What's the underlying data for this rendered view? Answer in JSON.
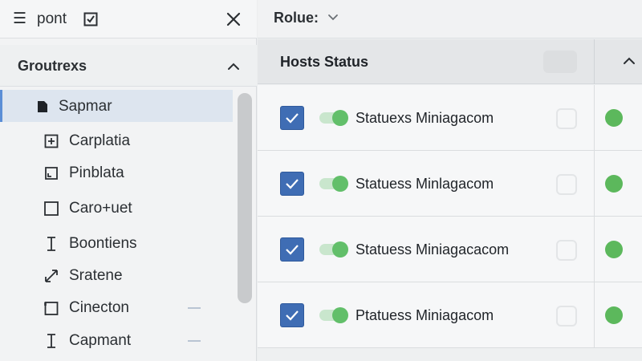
{
  "colors": {
    "accent": "#3f6db4",
    "selected_bg": "#dde5ef",
    "status_ok": "#5cb85c"
  },
  "topbar": {
    "title": "pont",
    "menu_icon": "menu-icon",
    "check_icon": "checklist-icon",
    "close_icon": "close-icon"
  },
  "group": {
    "label": "Groutrexs",
    "chevron_icon": "chevron-up-icon"
  },
  "nav": {
    "items": [
      {
        "label": "Sapmar",
        "icon": "file-icon",
        "selected": true
      },
      {
        "label": "Carplatia",
        "icon": "add-box-icon",
        "selected": false
      },
      {
        "label": "Pinblata",
        "icon": "frame-icon",
        "selected": false
      },
      {
        "label": "Caro+uet",
        "icon": "square-icon",
        "selected": false
      },
      {
        "label": "Boontiens",
        "icon": "text-cursor-icon",
        "selected": false
      },
      {
        "label": "Sratene",
        "icon": "expand-arrows-icon",
        "selected": false
      },
      {
        "label": "Cinecton",
        "icon": "square-frame-icon",
        "selected": false
      },
      {
        "label": "Capmant",
        "icon": "text-cursor-icon",
        "selected": false
      }
    ]
  },
  "right_top": {
    "role_label": "Rolue:",
    "role_chevron": "chevron-down-icon"
  },
  "hosts": {
    "header": "Hosts Status",
    "chevron_icon": "chevron-up-icon",
    "rows": [
      {
        "name": "Statuexs Miniagacom",
        "checked": true,
        "enabled": true,
        "status": "online"
      },
      {
        "name": "Statuess Minlagacom",
        "checked": true,
        "enabled": true,
        "status": "online"
      },
      {
        "name": "Statuess Miniagacacom",
        "checked": true,
        "enabled": true,
        "status": "online"
      },
      {
        "name": "Ptatuess Miniagacom",
        "checked": true,
        "enabled": true,
        "status": "online"
      }
    ]
  }
}
